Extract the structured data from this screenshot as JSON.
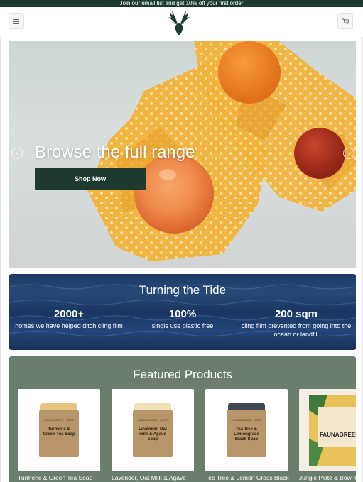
{
  "announcement": {
    "text": "Join our email list and get 10% off your first order"
  },
  "header": {
    "menu_icon": "menu-icon",
    "cart_icon": "cart-icon",
    "logo": "stag-logo"
  },
  "hero": {
    "title": "Browse the full range",
    "button_label": "Shop Now",
    "prev_icon": "chevron-left-icon",
    "next_icon": "chevron-right-icon"
  },
  "tide": {
    "title": "Turning the Tide",
    "stats": [
      {
        "value": "2000+",
        "label": "homes we have helped ditch cling film"
      },
      {
        "value": "100%",
        "label": "single use plastic free"
      },
      {
        "value": "200 sqm",
        "label": "cling film prevented from going into the ocean or landfill"
      }
    ]
  },
  "featured": {
    "title": "Featured Products",
    "products": [
      {
        "name": "Turmeric & Green Tea Soap",
        "box_label": "Turmeric & Green Tea Soap",
        "brand": "FAUNAGREEN · ARTS"
      },
      {
        "name": "Lavender, Oat Milk & Agave",
        "box_label": "Lavender, Oat milk & Agave soap",
        "brand": "FAUNAGREEN · ARTS"
      },
      {
        "name": "Tee Tree & Lemon Grass Black",
        "box_label": "Tea Tree & Lemongrass Black Soap",
        "brand": "FAUNAGREEN · ARTS"
      },
      {
        "name": "Jungle Plate & Bowl C",
        "box_label": "FAUNAGREEN",
        "brand": "FAUNAGREEN · ARTS"
      }
    ]
  },
  "colors": {
    "brand_dark": "#1d3a30",
    "featured_bg": "#6b7e6d",
    "tide_bg": "#1f4172",
    "wrap_yellow": "#f0b43a"
  }
}
